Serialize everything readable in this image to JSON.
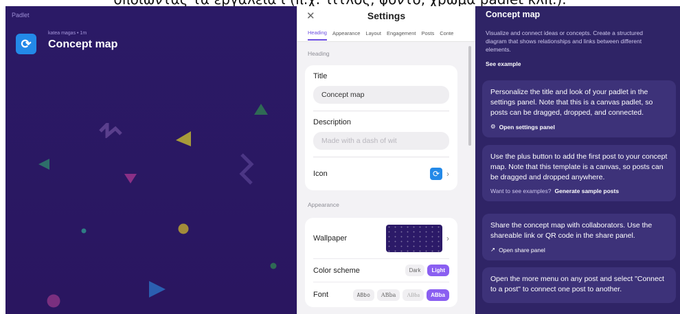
{
  "caption": "οποιώντας τα εργαλεία ι (π.χ. τίτλος, φόντο, χρώμα padlet κλπ.).",
  "canvas": {
    "brand": "Padlet",
    "author_line": "katea magas • 1m",
    "title": "Concept map"
  },
  "settings": {
    "title": "Settings",
    "tabs": [
      "Heading",
      "Appearance",
      "Layout",
      "Engagement",
      "Posts",
      "Conte"
    ],
    "heading_section": "Heading",
    "title_label": "Title",
    "title_value": "Concept map",
    "description_label": "Description",
    "description_placeholder": "Made with a dash of wit",
    "icon_label": "Icon",
    "appearance_section": "Appearance",
    "wallpaper_label": "Wallpaper",
    "color_scheme_label": "Color scheme",
    "color_scheme_options": [
      "Dark",
      "Light"
    ],
    "color_scheme_selected": "Light",
    "font_label": "Font",
    "font_options": [
      "ABbo",
      "ABba",
      "ABba",
      "ABba"
    ],
    "font_selected_index": 3
  },
  "info": {
    "title": "Concept map",
    "description": "Visualize and connect ideas or concepts. Create a structured diagram that shows relationships and links between different elements.",
    "see_example": "See example",
    "tips": [
      {
        "text": "Personalize the title and look of your padlet in the settings panel. Note that this is a canvas padlet, so posts can be dragged, dropped, and connected.",
        "action_label": "Open settings panel",
        "action_icon": "gear-icon"
      },
      {
        "text": "Use the plus button to add the first post to your concept map. Note that this template is a canvas, so posts can be dragged and dropped anywhere.",
        "action_prefix": "Want to see examples?",
        "action_label": "Generate sample posts"
      },
      {
        "text": "Share the concept map with collaborators. Use the shareable link or QR code in the share panel.",
        "action_label": "Open share panel",
        "action_icon": "share-icon"
      },
      {
        "text": "Open the more menu on any post and select \"Connect to a post\" to connect one post to another."
      }
    ]
  },
  "colors": {
    "accent": "#6c4ee0",
    "canvas_bg": "#2b1a66",
    "info_bg": "#2f2466",
    "logo_blue": "#2389e8"
  }
}
